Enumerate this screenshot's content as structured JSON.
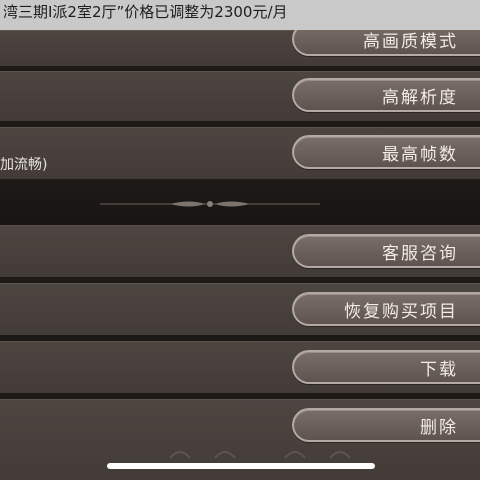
{
  "notification": {
    "text": "湾三期I派2室2厅”价格已调整为2300元/月"
  },
  "settings": {
    "partial_label": "加流畅)",
    "buttons": [
      {
        "label": "高画质模式"
      },
      {
        "label": "高解析度"
      },
      {
        "label": "最高帧数"
      },
      {
        "label": "客服咨询"
      },
      {
        "label": "恢复购买项目"
      },
      {
        "label": "下载"
      },
      {
        "label": "删除"
      }
    ]
  },
  "colors": {
    "panel": "#4d4540",
    "separator": "#1d1917",
    "button_fill": "#6e625c",
    "button_border": "#b5aaa3",
    "text": "#f2ece8"
  }
}
